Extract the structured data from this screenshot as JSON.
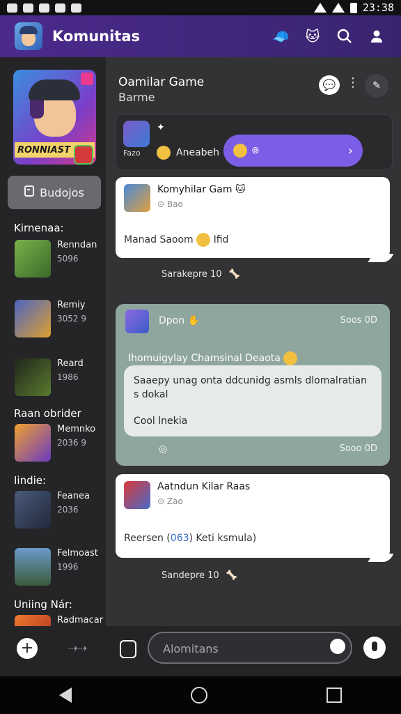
{
  "status": {
    "time": "23:38"
  },
  "app": {
    "title": "Komunitas"
  },
  "sidebar": {
    "featured_label": "RONNIAST",
    "buddies_label": "Budojos",
    "sections": [
      "Kirnenaa:",
      "Raan obrider",
      "Iindie:",
      "Uniing Nár:"
    ],
    "games": [
      {
        "name": "Renndan",
        "meta": "5096",
        "color": "#5c8a3a"
      },
      {
        "name": "Remiy",
        "meta": "3052 9",
        "color": "#3d4f9a"
      },
      {
        "name": "Reard",
        "meta": "1986",
        "color": "#2f3a2a"
      },
      {
        "name": "Memnko",
        "meta": "2036 9",
        "color": "#d8891a"
      },
      {
        "name": "Feanea",
        "meta": "2036",
        "color": "#3b4766"
      },
      {
        "name": "Felmoast",
        "meta": "1996",
        "color": "#4f7c9a"
      },
      {
        "name": "Radmacar",
        "meta": "",
        "color": "#e07030"
      }
    ]
  },
  "channel": {
    "title": "Oamilar Game",
    "subtitle": "Barme"
  },
  "composer": {
    "small": "Fazo",
    "text": "Aneabeh"
  },
  "posts": [
    {
      "name": "Komyhilar Gam",
      "meta": "Bao",
      "body": "Manad Saoom",
      "trailing": "Ifid",
      "reply": "Sarakepre 10"
    },
    {
      "name": "Aatndun Kilar Raas",
      "meta": "Zao",
      "body_prefix": "Reersen (",
      "body_link": "063",
      "body_suffix": ") Keti ksmula)",
      "reply": "Sandepre 10"
    }
  ],
  "featured_post": {
    "name": "Dpon",
    "time": "Soos 0D",
    "headline": "Ihomuigylay Chamsinal Deaota",
    "inner_text": "Saaepy unag onta ddcunidg asmls dlomalratian s dokal",
    "inner_text2": "Cool lnekia",
    "footer_time": "Sooo 0D"
  },
  "bottombar": {
    "search_placeholder": "Alomitans"
  }
}
